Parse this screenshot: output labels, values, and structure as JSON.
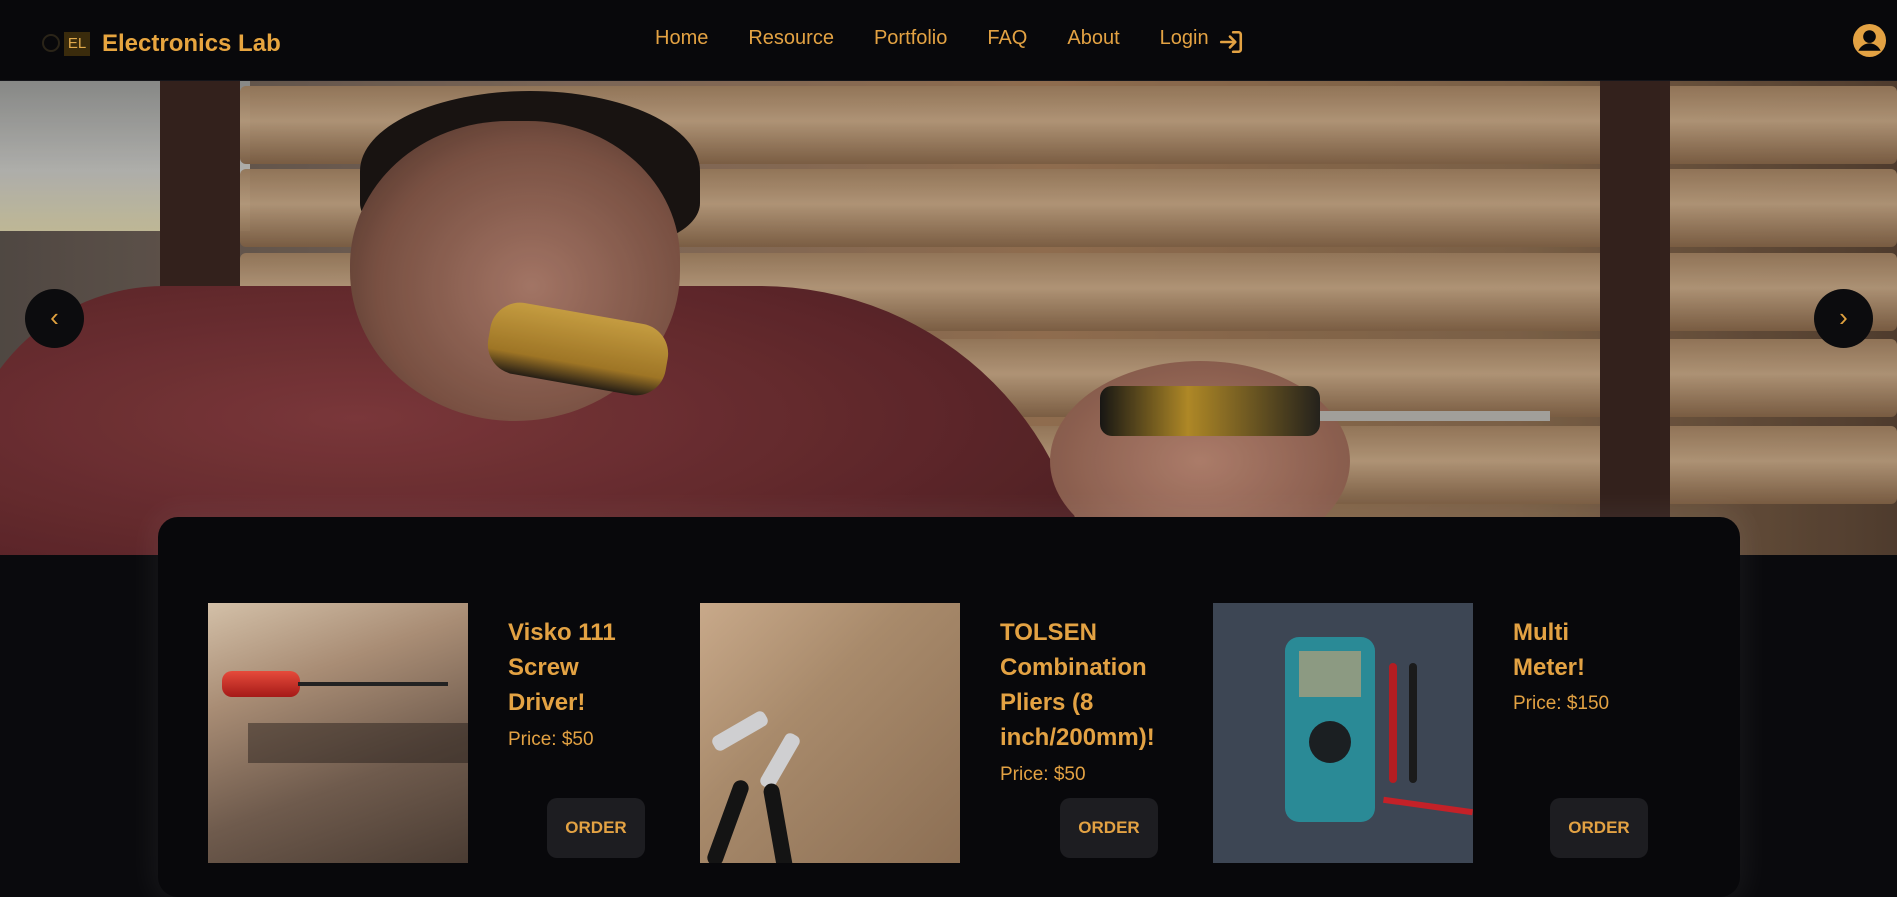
{
  "nav": {
    "brand_logo_text": "EL",
    "brand_name": "Electronics Lab",
    "links": [
      "Home",
      "Resource",
      "Portfolio",
      "FAQ",
      "About",
      "Login"
    ],
    "login_icon": "sign-in-icon",
    "avatar_icon": "user-circle-icon"
  },
  "hero": {
    "prev_label": "‹",
    "next_label": "›"
  },
  "products": [
    {
      "title": "Visko 111 Screw Driver!",
      "price": "Price: $50",
      "button": "ORDER",
      "image_icon": "screwdriver-image"
    },
    {
      "title": "TOLSEN Combination Pliers (8 inch/200mm)!",
      "price": "Price: $50",
      "button": "ORDER",
      "image_icon": "pliers-image"
    },
    {
      "title": "Multi Meter!",
      "price": "Price: $150",
      "button": "ORDER",
      "image_icon": "multimeter-image"
    }
  ],
  "colors": {
    "accent": "#e3a243",
    "background": "#0a0a0d",
    "panel": "#08080b",
    "button": "#1d1d21"
  }
}
